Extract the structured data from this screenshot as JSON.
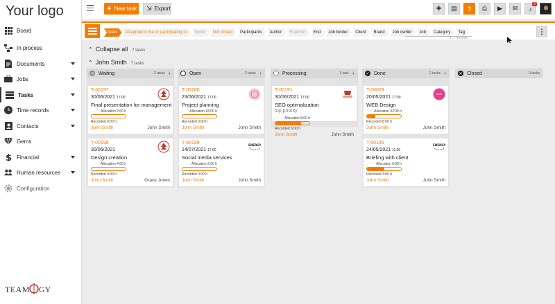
{
  "app": {
    "logo_text": "Your logo"
  },
  "sidebar": {
    "items": [
      {
        "label": "Board",
        "icon": "grid-icon",
        "caret": false
      },
      {
        "label": "In process",
        "icon": "flow-icon",
        "caret": false
      },
      {
        "label": "Documents",
        "icon": "document-icon",
        "caret": true
      },
      {
        "label": "Jobs",
        "icon": "briefcase-icon",
        "caret": true
      },
      {
        "label": "Tasks",
        "icon": "tasks-icon",
        "caret": true
      },
      {
        "label": "Time records",
        "icon": "clock-icon",
        "caret": true
      },
      {
        "label": "Contacts",
        "icon": "contacts-icon",
        "caret": true
      },
      {
        "label": "Gems",
        "icon": "gem-icon",
        "caret": false
      },
      {
        "label": "Financial",
        "icon": "dollar-icon",
        "caret": true
      },
      {
        "label": "Human resources",
        "icon": "people-icon",
        "caret": true
      },
      {
        "label": "Configuration",
        "icon": "gear-icon",
        "caret": false
      }
    ],
    "active_label": "Tasks",
    "footer_brand": "TEAMOGY"
  },
  "toolbar": {
    "new_task_label": "New task",
    "export_label": "Export",
    "notification_count": "2",
    "icons": [
      "add-icon",
      "note-icon",
      "help-icon",
      "print-icon",
      "video-icon",
      "chat-icon",
      "bell-icon"
    ]
  },
  "filters": {
    "chips": [
      "Tasks",
      "Assigned to me or participating in",
      "Sprint",
      "Not closed",
      "Participants",
      "Author",
      "Reporter",
      "End",
      "Job binder",
      "Client",
      "Brand",
      "Job owner",
      "Job",
      "Category",
      "Tag"
    ],
    "selected": "Tasks",
    "search_placeholder": "",
    "search_count": "7/17 records"
  },
  "groups": {
    "collapse_all_label": "Collapse all",
    "collapse_all_count": "7 tasks",
    "person_label": "John Smith",
    "person_count": "7 tasks"
  },
  "columns": [
    {
      "name": "Waiting",
      "count": "2 tasks",
      "color": "#888888",
      "glyph": "◷"
    },
    {
      "name": "Open",
      "count": "2 tasks",
      "color": "#ffffff",
      "glyph": ""
    },
    {
      "name": "Processing",
      "count": "1 task",
      "color": "#ffffff",
      "glyph": ""
    },
    {
      "name": "Done",
      "count": "2 tasks",
      "color": "#222222",
      "glyph": "✓"
    },
    {
      "name": "Closed",
      "count": "0 tasks",
      "color": "#222222",
      "glyph": "✕"
    }
  ],
  "cards": [
    {
      "col": 0,
      "row": 0,
      "id": "T-00197",
      "date": "30/06/2021",
      "time": "17:00",
      "title": "Final presentation for management",
      "sub": "",
      "allocation": "Allocation 2:00 h",
      "recorded": "Recorded 0:00 h",
      "progress": 0.0,
      "assignee": "John Smith",
      "owner": "John Smith",
      "brand": "red-tree-logo"
    },
    {
      "col": 0,
      "row": 1,
      "id": "T-00196",
      "date": "30/06/2021",
      "time": "",
      "title": "Design creation",
      "sub": "",
      "allocation": "Allocation 4:00 h",
      "recorded": "Recorded 0:00 h",
      "progress": 0.0,
      "assignee": "John Smith",
      "owner": "Grace Jones",
      "brand": "red-tree-logo"
    },
    {
      "col": 1,
      "row": 0,
      "id": "T-00200",
      "date": "23/06/2021",
      "time": "17:00",
      "title": "Project planning",
      "sub": "",
      "allocation": "Allocation 18:00 h",
      "recorded": "Recorded 0:00 h",
      "progress": 0.0,
      "assignee": "John Smith",
      "owner": "John Smith",
      "brand": "pink-round-logo"
    },
    {
      "col": 1,
      "row": 1,
      "id": "T-00198",
      "date": "14/07/2021",
      "time": "17:00",
      "title": "Social media services",
      "sub": "",
      "allocation": "Allocation 2:00 h",
      "recorded": "Recorded 0:00 h",
      "progress": 0.0,
      "assignee": "John Smith",
      "owner": "John Smith",
      "brand": "energy-logo"
    },
    {
      "col": 2,
      "row": 0,
      "id": "T-00191",
      "date": "30/06/2021",
      "time": "17:00",
      "title": "SEO optimalization",
      "sub": "top priority",
      "allocation": "Allocation 8:00 h",
      "recorded": "Recorded 6:00 h",
      "progress": 0.75,
      "assignee": "John Smith",
      "owner": "John Smith",
      "brand": "coffee-logo"
    },
    {
      "col": 3,
      "row": 0,
      "id": "T-00003",
      "date": "20/05/2021",
      "time": "17:00",
      "title": "WEB Design",
      "sub": "",
      "allocation": "Allocation 32:00 h",
      "recorded": "Recorded 8:00 h",
      "progress": 0.25,
      "assignee": "John Smith",
      "owner": "John Smith",
      "brand": "pink-circle-logo"
    },
    {
      "col": 3,
      "row": 1,
      "id": "T-00185",
      "date": "24/05/2021",
      "time": "11:00",
      "title": "Briefing with client",
      "sub": "",
      "allocation": "Allocation 6:00 h",
      "recorded": "Recorded 3:00 h",
      "progress": 0.5,
      "assignee": "John Smith",
      "owner": "John Smith",
      "brand": "energy-logo"
    }
  ],
  "brand_texts": {
    "energy": "ENERGY"
  },
  "colors": {
    "accent": "#f47c00"
  }
}
